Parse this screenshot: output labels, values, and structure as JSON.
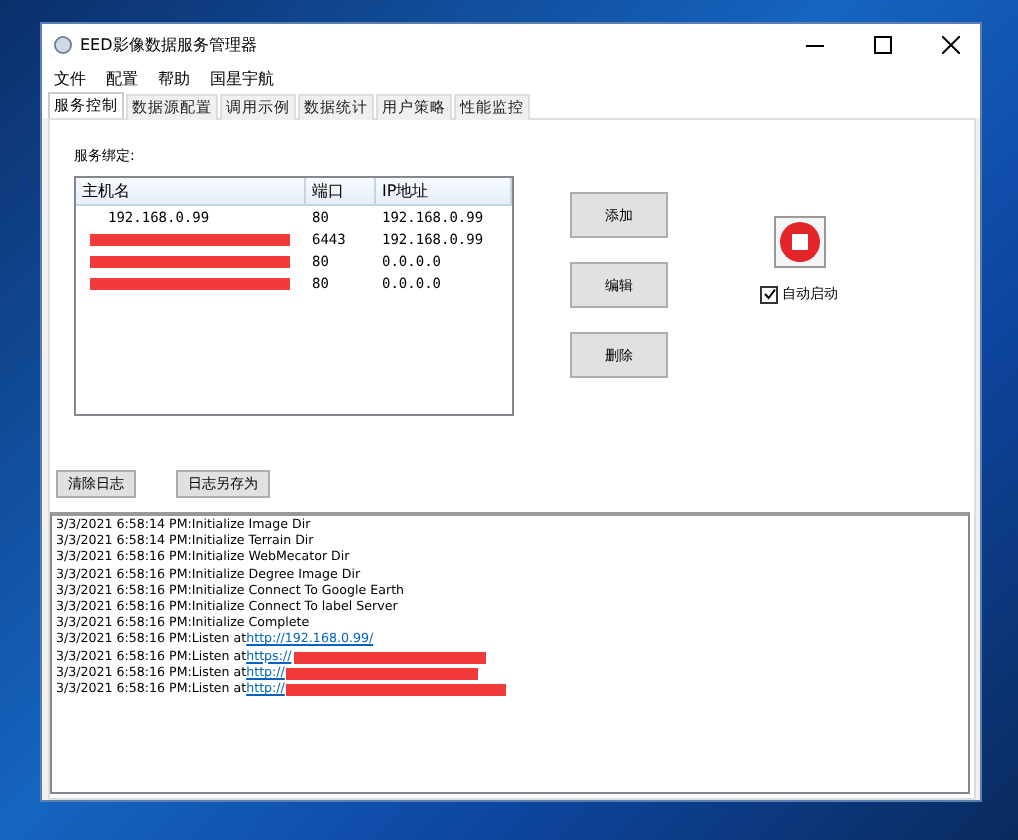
{
  "window": {
    "title": "EED影像数据服务管理器"
  },
  "menu": [
    "文件",
    "配置",
    "帮助",
    "国星宇航"
  ],
  "tabs": [
    {
      "label": "服务控制",
      "selected": true
    },
    {
      "label": "数据源配置",
      "selected": false
    },
    {
      "label": "调用示例",
      "selected": false
    },
    {
      "label": "数据统计",
      "selected": false
    },
    {
      "label": "用户策略",
      "selected": false
    },
    {
      "label": "性能监控",
      "selected": false
    }
  ],
  "binding_label": "服务绑定:",
  "table": {
    "columns": [
      "主机名",
      "端口",
      "IP地址"
    ],
    "rows": [
      {
        "host": "192.168.0.99",
        "host_redacted": false,
        "port": "80",
        "ip": "192.168.0.99"
      },
      {
        "host_redacted": true,
        "port": "6443",
        "ip": "192.168.0.99"
      },
      {
        "host_redacted": true,
        "port": "80",
        "ip": "0.0.0.0"
      },
      {
        "host_redacted": true,
        "port": "80",
        "ip": "0.0.0.0"
      }
    ]
  },
  "buttons": [
    "添加",
    "编辑",
    "删除"
  ],
  "service": {
    "running": true,
    "auto_start": {
      "label": "自动启动",
      "checked": true
    }
  },
  "log_buttons": [
    "清除日志",
    "日志另存为"
  ],
  "log": [
    {
      "text": "3/3/2021 6:58:14 PM:Initialize Image Dir"
    },
    {
      "text": "3/3/2021 6:58:14 PM:Initialize Terrain Dir"
    },
    {
      "text": "3/3/2021 6:58:16 PM:Initialize WebMecator Dir"
    },
    {
      "text": "3/3/2021 6:58:16 PM:Initialize Degree Image Dir"
    },
    {
      "text": "3/3/2021 6:58:16 PM:Initialize Connect To Google Earth"
    },
    {
      "text": "3/3/2021 6:58:16 PM:Initialize Connect To label Server"
    },
    {
      "text": "3/3/2021 6:58:16 PM:Initialize Complete"
    },
    {
      "text": "3/3/2021 6:58:16 PM:Listen at ",
      "link": "http://192.168.0.99/",
      "redacted": false
    },
    {
      "text": "3/3/2021 6:58:16 PM:Listen at ",
      "link": "https://",
      "redacted": true
    },
    {
      "text": "3/3/2021 6:58:16 PM:Listen at ",
      "link": "http://",
      "redacted": true
    },
    {
      "text": "3/3/2021 6:58:16 PM:Listen at ",
      "link": "http://",
      "redacted": true
    }
  ]
}
